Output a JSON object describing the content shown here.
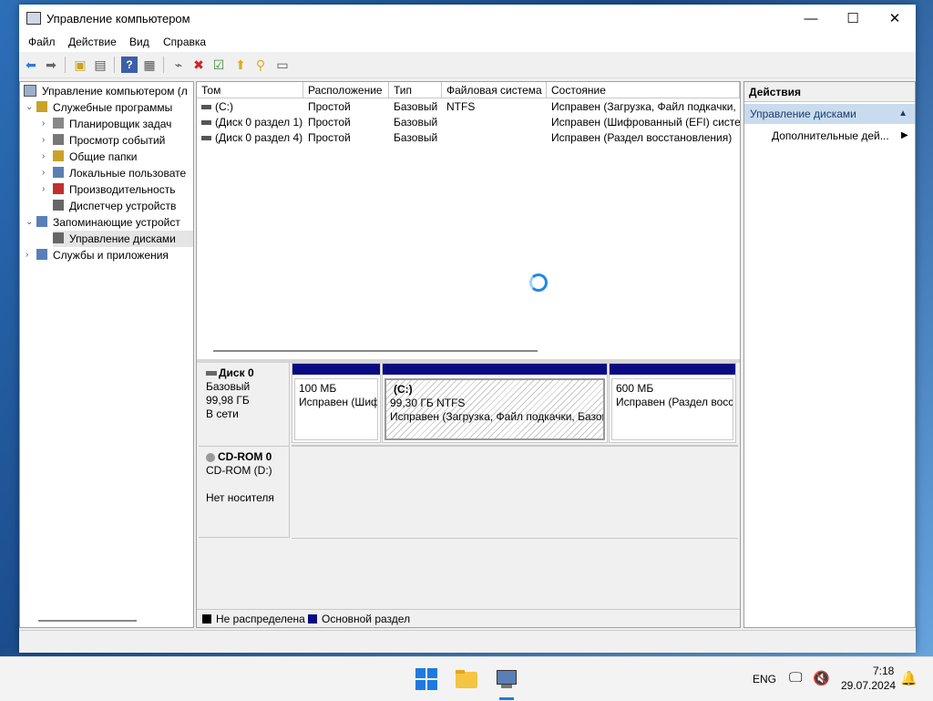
{
  "window": {
    "title": "Управление компьютером"
  },
  "menu": [
    "Файл",
    "Действие",
    "Вид",
    "Справка"
  ],
  "tree": {
    "root": "Управление компьютером (л",
    "items": [
      {
        "label": "Служебные программы",
        "level": 1,
        "expander": "⌄"
      },
      {
        "label": "Планировщик задач",
        "level": 2,
        "expander": "›"
      },
      {
        "label": "Просмотр событий",
        "level": 2,
        "expander": "›"
      },
      {
        "label": "Общие папки",
        "level": 2,
        "expander": "›"
      },
      {
        "label": "Локальные пользовате",
        "level": 2,
        "expander": "›"
      },
      {
        "label": "Производительность",
        "level": 2,
        "expander": "›"
      },
      {
        "label": "Диспетчер устройств",
        "level": 2,
        "expander": ""
      },
      {
        "label": "Запоминающие устройст",
        "level": 1,
        "expander": "⌄"
      },
      {
        "label": "Управление дисками",
        "level": 2,
        "expander": "",
        "selected": true
      },
      {
        "label": "Службы и приложения",
        "level": 1,
        "expander": "›"
      }
    ]
  },
  "volumes": {
    "columns": [
      "Том",
      "Расположение",
      "Тип",
      "Файловая система",
      "Состояние"
    ],
    "rows": [
      [
        "(C:)",
        "Простой",
        "Базовый",
        "NTFS",
        "Исправен (Загрузка, Файл подкачки,"
      ],
      [
        "(Диск 0 раздел 1)",
        "Простой",
        "Базовый",
        "",
        "Исправен (Шифрованный (EFI) систе"
      ],
      [
        "(Диск 0 раздел 4)",
        "Простой",
        "Базовый",
        "",
        "Исправен (Раздел восстановления)"
      ]
    ]
  },
  "disks": [
    {
      "name": "Диск 0",
      "type": "Базовый",
      "size": "99,98 ГБ",
      "status": "В сети",
      "partitions": [
        {
          "title": "",
          "size": "100 МБ",
          "state": "Исправен (Шиф"
        },
        {
          "title": "(C:)",
          "size": "99,30 ГБ NTFS",
          "state": "Исправен (Загрузка, Файл подкачки, Базов"
        },
        {
          "title": "",
          "size": "600 МБ",
          "state": "Исправен (Раздел восст"
        }
      ]
    },
    {
      "name": "CD-ROM 0",
      "type": "CD-ROM (D:)",
      "size": "",
      "status": "Нет носителя"
    }
  ],
  "legend": [
    {
      "label": "Не распределена",
      "color": "#000000"
    },
    {
      "label": "Основной раздел",
      "color": "#0a0a82"
    }
  ],
  "actions": {
    "header": "Действия",
    "section": "Управление дисками",
    "more": "Дополнительные дей..."
  },
  "taskbar": {
    "lang": "ENG",
    "time": "7:18",
    "date": "29.07.2024"
  }
}
